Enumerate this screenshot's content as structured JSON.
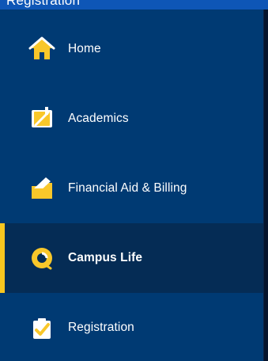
{
  "top_partial_text": "Registration",
  "sidebar": {
    "items": [
      {
        "label": "Home",
        "icon": "home-icon",
        "active": false
      },
      {
        "label": "Academics",
        "icon": "academics-book-icon",
        "active": false
      },
      {
        "label": "Financial Aid & Billing",
        "icon": "financial-aid-folder-icon",
        "active": false
      },
      {
        "label": "Campus Life",
        "icon": "campus-life-ring-icon",
        "active": true
      },
      {
        "label": "Registration",
        "icon": "registration-checklist-icon",
        "active": false
      }
    ]
  },
  "colors": {
    "sidebar_bg": "#003a73",
    "active_bg": "#052c55",
    "accent": "#f8c61f",
    "text": "#ffffff"
  }
}
